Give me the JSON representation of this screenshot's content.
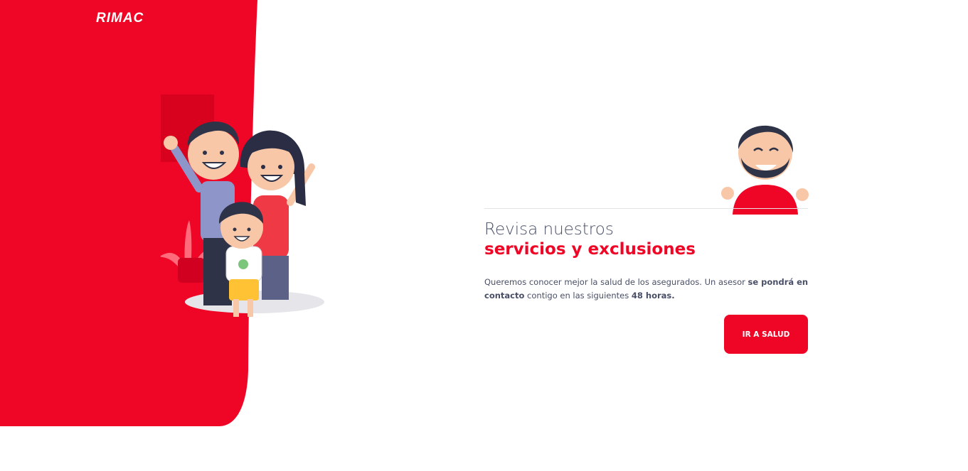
{
  "brand": {
    "logo_text": "RIMAC",
    "primary_color": "#ef0525",
    "text_color": "#494f66"
  },
  "hero": {
    "title_line1": "Revisa nuestros",
    "title_line2": "servicios y exclusiones",
    "description": {
      "part1": "Queremos conocer mejor la salud de los asegurados. Un asesor ",
      "bold1": "se pondrá en contacto",
      "part2": " contigo en las siguientes ",
      "bold2": "48 horas."
    },
    "cta_label": "IR A SALUD"
  },
  "illustrations": {
    "family": "family-illustration",
    "advisor": "advisor-thumbs-up-illustration"
  }
}
